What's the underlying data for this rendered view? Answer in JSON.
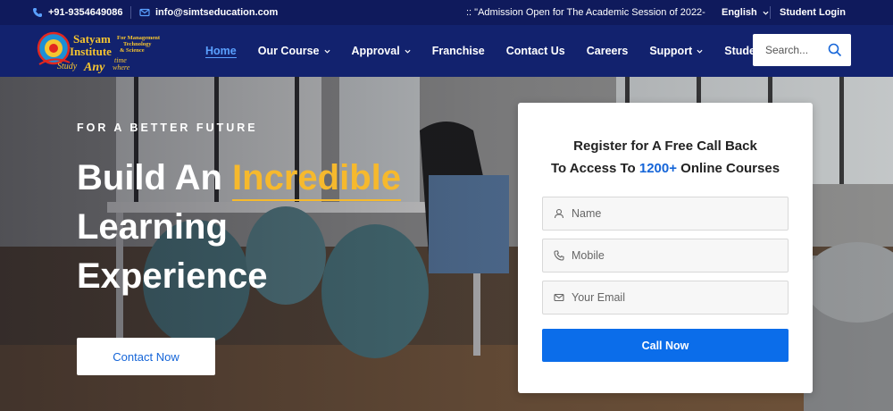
{
  "topbar": {
    "phone": "+91-9354649086",
    "email": "info@simtseducation.com",
    "ticker": ":: \"Admission Open for The Academic Session of 2022-",
    "language": "English",
    "student_login": "Student Login"
  },
  "logo": {
    "name_line1": "Satyam",
    "name_line2": "Institute",
    "side_line1": "For Management",
    "side_line2": "Technology",
    "side_line3": "& Science",
    "tagline_a": "Study",
    "tagline_b": "Any",
    "tagline_c": "time",
    "tagline_d": "where"
  },
  "nav": {
    "items": [
      {
        "label": "Home",
        "active": true,
        "dropdown": false
      },
      {
        "label": "Our Course",
        "active": false,
        "dropdown": true
      },
      {
        "label": "Approval",
        "active": false,
        "dropdown": true
      },
      {
        "label": "Franchise",
        "active": false,
        "dropdown": false
      },
      {
        "label": "Contact Us",
        "active": false,
        "dropdown": false
      },
      {
        "label": "Careers",
        "active": false,
        "dropdown": false
      },
      {
        "label": "Support",
        "active": false,
        "dropdown": true
      },
      {
        "label": "Student Zone",
        "active": false,
        "dropdown": true
      }
    ],
    "search_placeholder": "Search..."
  },
  "hero": {
    "eyebrow": "FOR A BETTER FUTURE",
    "headline_a": "Build An ",
    "headline_highlight": "Incredible",
    "headline_b": "Learning",
    "headline_c": "Experience",
    "cta": "Contact Now"
  },
  "form": {
    "title_line1": "Register for A Free Call Back",
    "title_line2_a": "To Access To ",
    "title_line2_num": "1200+",
    "title_line2_b": " Online Courses",
    "name_placeholder": "Name",
    "mobile_placeholder": "Mobile",
    "email_placeholder": "Your Email",
    "submit": "Call Now"
  },
  "colors": {
    "topbar_bg": "#0f1a5c",
    "nav_bg": "#12226e",
    "accent_blue": "#1565d8",
    "highlight_yellow": "#f6b92d",
    "button_blue": "#0b6dea"
  }
}
